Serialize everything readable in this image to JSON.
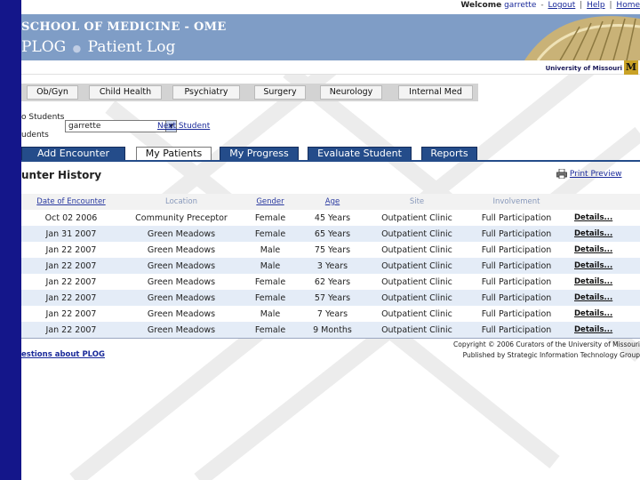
{
  "topbar": {
    "welcome_label": "Welcome",
    "username": "garrette",
    "separator": "-",
    "links": [
      "Logout",
      "Help",
      "Home"
    ]
  },
  "banner": {
    "school_title": "SCHOOL OF MEDICINE - OME",
    "app_prefix": "PLOG",
    "app_suffix": "Patient Log",
    "university": "University of Missouri",
    "logo_letter": "M",
    "bg_color": "#7f9dc6"
  },
  "clerkships": [
    "Ob/Gyn",
    "Child Health",
    "Psychiatry",
    "Surgery",
    "Neurology",
    "Internal Med"
  ],
  "student_select": {
    "label_top": "o Students",
    "label_bottom": "udents",
    "selected": "garrette",
    "next_link": "Next Student"
  },
  "nav_tabs": [
    {
      "label": "Add Encounter",
      "active": false
    },
    {
      "label": "My Patients",
      "active": true
    },
    {
      "label": "My Progress",
      "active": false
    },
    {
      "label": "Evaluate Student",
      "active": false
    },
    {
      "label": "Reports",
      "active": false
    }
  ],
  "section": {
    "title": "unter History",
    "print_preview": "Print Preview"
  },
  "table": {
    "headers": [
      "Date of Encounter",
      "Location",
      "Gender",
      "Age",
      "Site",
      "Involvement",
      ""
    ],
    "sortable": [
      true,
      false,
      true,
      true,
      false,
      false,
      false
    ],
    "rows": [
      [
        "Oct 02 2006",
        "Community Preceptor",
        "Female",
        "45 Years",
        "Outpatient Clinic",
        "Full Participation",
        "Details..."
      ],
      [
        "Jan 31 2007",
        "Green Meadows",
        "Female",
        "65 Years",
        "Outpatient Clinic",
        "Full Participation",
        "Details..."
      ],
      [
        "Jan 22 2007",
        "Green Meadows",
        "Male",
        "75 Years",
        "Outpatient Clinic",
        "Full Participation",
        "Details..."
      ],
      [
        "Jan 22 2007",
        "Green Meadows",
        "Male",
        "3 Years",
        "Outpatient Clinic",
        "Full Participation",
        "Details..."
      ],
      [
        "Jan 22 2007",
        "Green Meadows",
        "Female",
        "62 Years",
        "Outpatient Clinic",
        "Full Participation",
        "Details..."
      ],
      [
        "Jan 22 2007",
        "Green Meadows",
        "Female",
        "57 Years",
        "Outpatient Clinic",
        "Full Participation",
        "Details..."
      ],
      [
        "Jan 22 2007",
        "Green Meadows",
        "Male",
        "7 Years",
        "Outpatient Clinic",
        "Full Participation",
        "Details..."
      ],
      [
        "Jan 22 2007",
        "Green Meadows",
        "Female",
        "9 Months",
        "Outpatient Clinic",
        "Full Participation",
        "Details..."
      ]
    ]
  },
  "footer": {
    "questions": "estions about PLOG",
    "copyright": "Copyright © 2006    Curators of the University of Missouri",
    "published": "Published by Strategic Information Technology Group"
  },
  "colors": {
    "left_bar": "#14168a",
    "nav_tab": "#244c8a",
    "row_alt": "#e4ecf7",
    "link": "#1a2a9a"
  }
}
